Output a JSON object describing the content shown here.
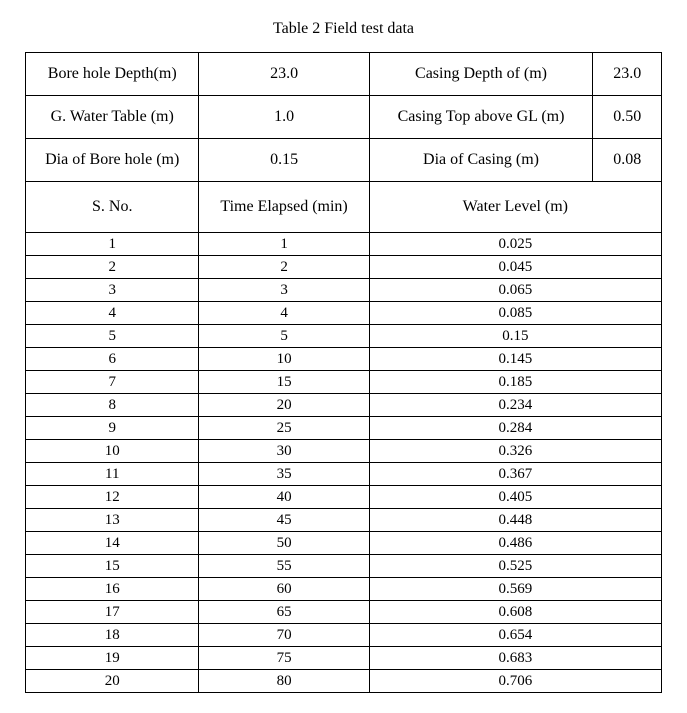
{
  "title": "Table 2 Field test data",
  "meta": [
    {
      "label": "Bore hole Depth(m)",
      "value": "23.0",
      "label2": "Casing Depth of (m)",
      "value2": "23.0"
    },
    {
      "label": "G. Water Table (m)",
      "value": "1.0",
      "label2": "Casing Top above GL (m)",
      "value2": "0.50"
    },
    {
      "label": "Dia of Bore hole (m)",
      "value": "0.15",
      "label2": "Dia of Casing (m)",
      "value2": "0.08"
    }
  ],
  "headers": {
    "sno": "S. No.",
    "time": "Time Elapsed (min)",
    "level": "Water Level (m)"
  },
  "rows": [
    {
      "sno": "1",
      "time": "1",
      "level": "0.025"
    },
    {
      "sno": "2",
      "time": "2",
      "level": "0.045"
    },
    {
      "sno": "3",
      "time": "3",
      "level": "0.065"
    },
    {
      "sno": "4",
      "time": "4",
      "level": "0.085"
    },
    {
      "sno": "5",
      "time": "5",
      "level": "0.15"
    },
    {
      "sno": "6",
      "time": "10",
      "level": "0.145"
    },
    {
      "sno": "7",
      "time": "15",
      "level": "0.185"
    },
    {
      "sno": "8",
      "time": "20",
      "level": "0.234"
    },
    {
      "sno": "9",
      "time": "25",
      "level": "0.284"
    },
    {
      "sno": "10",
      "time": "30",
      "level": "0.326"
    },
    {
      "sno": "11",
      "time": "35",
      "level": "0.367"
    },
    {
      "sno": "12",
      "time": "40",
      "level": "0.405"
    },
    {
      "sno": "13",
      "time": "45",
      "level": "0.448"
    },
    {
      "sno": "14",
      "time": "50",
      "level": "0.486"
    },
    {
      "sno": "15",
      "time": "55",
      "level": "0.525"
    },
    {
      "sno": "16",
      "time": "60",
      "level": "0.569"
    },
    {
      "sno": "17",
      "time": "65",
      "level": "0.608"
    },
    {
      "sno": "18",
      "time": "70",
      "level": "0.654"
    },
    {
      "sno": "19",
      "time": "75",
      "level": "0.683"
    },
    {
      "sno": "20",
      "time": "80",
      "level": "0.706"
    }
  ]
}
